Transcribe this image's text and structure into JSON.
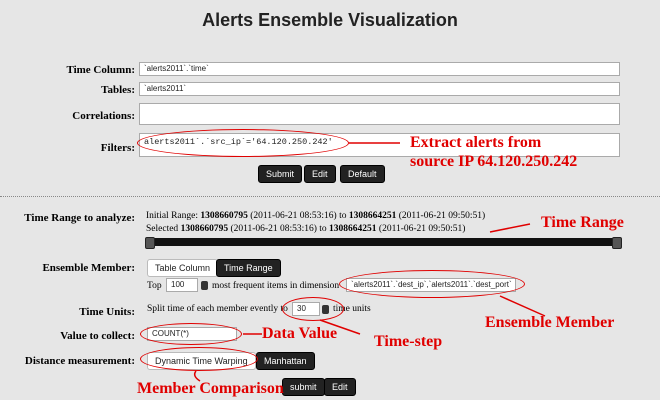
{
  "title": "Alerts Ensemble Visualization",
  "top_form": {
    "time_column_label": "Time Column:",
    "time_column_value": "`alerts2011`.`time`",
    "tables_label": "Tables:",
    "tables_value": "`alerts2011`",
    "correlations_label": "Correlations:",
    "correlations_value": "",
    "filters_label": "Filters:",
    "filters_value": "alerts2011`.`src_ip`='64.120.250.242'",
    "buttons": {
      "submit": "Submit",
      "edit": "Edit",
      "default": "Default"
    }
  },
  "time_range": {
    "label": "Time Range to analyze:",
    "initial_prefix": "Initial Range:",
    "initial_start": "1308660795",
    "initial_start_date": "(2011-06-21 08:53:16)",
    "to1": "to",
    "initial_end": "1308664251",
    "initial_end_date": "(2011-06-21 09:50:51)",
    "selected_prefix": "Selected",
    "selected_start": "1308660795",
    "selected_start_date": "(2011-06-21 08:53:16)",
    "to2": "to",
    "selected_end": "1308664251",
    "selected_end_date": "(2011-06-21 09:50:51)",
    "slider_range": [
      0,
      1
    ]
  },
  "ensemble": {
    "label": "Ensemble Member:",
    "tab_table_column": "Table Column",
    "tab_time_range": "Time Range",
    "top_prefix": "Top",
    "top_value": "100",
    "top_suffix": "most frequent items in dimension",
    "dimension_value": "`alerts2011`.`dest_ip`,`alerts2011`.`dest_port`"
  },
  "time_units": {
    "label": "Time Units:",
    "prefix": "Split time of each member evently to",
    "value": "30",
    "suffix": "time units"
  },
  "value_collect": {
    "label": "Value to collect:",
    "value": "COUNT(*)"
  },
  "distance": {
    "label": "Distance measurement:",
    "option_dtw": "Dynamic Time Warping",
    "option_manhattan": "Manhattan"
  },
  "bottom_buttons": {
    "submit": "submit",
    "edit": "Edit"
  },
  "annotations": {
    "extract_line1": "Extract alerts from",
    "extract_line2": "source IP 64.120.250.242",
    "time_range": "Time Range",
    "ensemble_member": "Ensemble Member",
    "time_step": "Time-step",
    "data_value": "Data Value",
    "member_comparison": "Member Comparison"
  },
  "colors": {
    "annotation": "#e00000",
    "background": "#e6e6e6",
    "button": "#222222"
  }
}
